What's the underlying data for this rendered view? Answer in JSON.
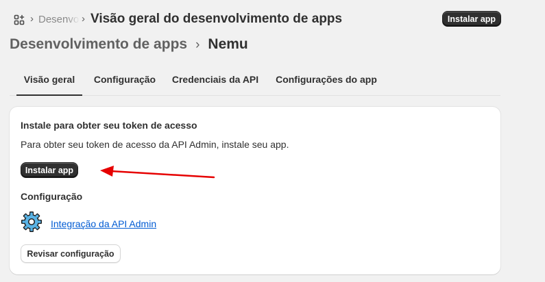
{
  "breadcrumb": {
    "parent": "Desenvolvimento de apps",
    "current": "Visão geral do desenvolvimento de apps"
  },
  "top_install_label": "Instalar app",
  "header": {
    "parent": "Desenvolvimento de apps",
    "separator": "›",
    "app_name": "Nemu"
  },
  "tabs": [
    {
      "label": "Visão geral",
      "active": true
    },
    {
      "label": "Configuração",
      "active": false
    },
    {
      "label": "Credenciais da API",
      "active": false
    },
    {
      "label": "Configurações do app",
      "active": false
    }
  ],
  "card": {
    "title": "Instale para obter seu token de acesso",
    "description": "Para obter seu token de acesso da API Admin, instale seu app.",
    "install_label": "Instalar app",
    "config_title": "Configuração",
    "config_link": "Integração da API Admin",
    "review_label": "Revisar configuração"
  },
  "icons": {
    "apps": "apps-grid-icon",
    "gear": "gear-icon",
    "arrow": "red-arrow-annotation"
  },
  "colors": {
    "accent_dark": "#303030",
    "link": "#005bd3",
    "annotation": "#e60000"
  }
}
